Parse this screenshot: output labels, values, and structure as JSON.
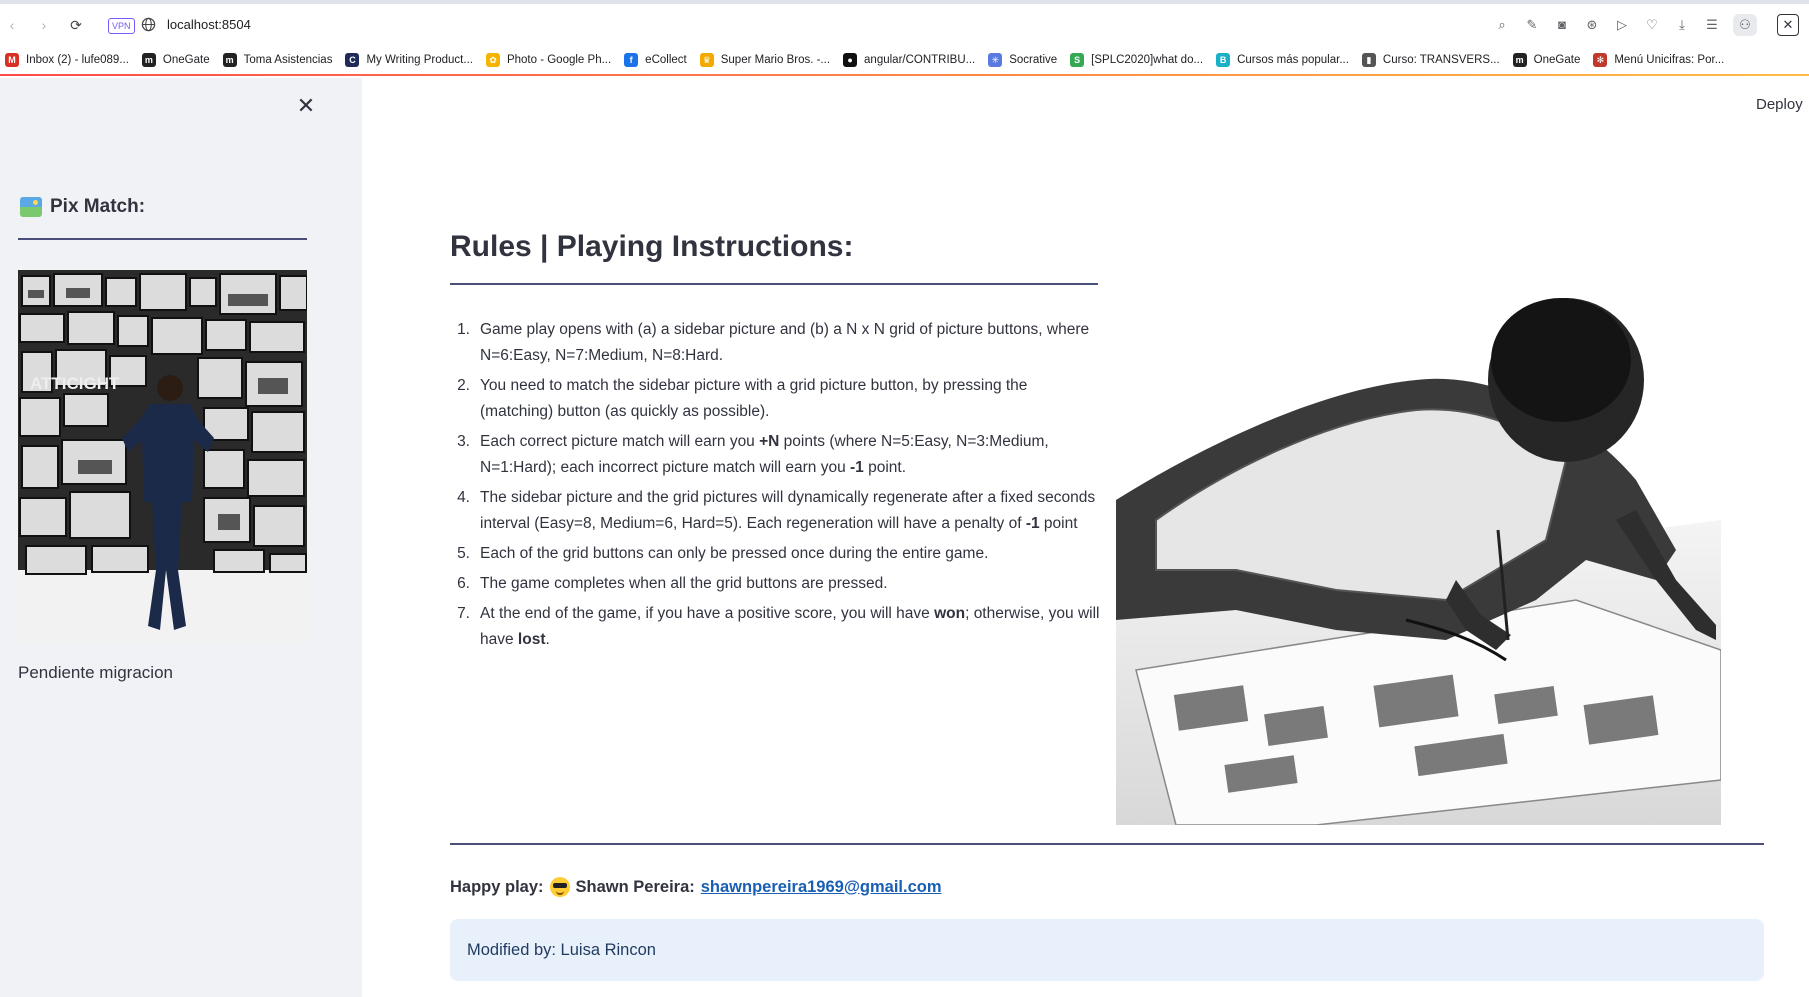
{
  "browser": {
    "url": "localhost:8504",
    "vpn_label": "VPN",
    "bookmarks": [
      {
        "label": "Inbox (2) - lufe089...",
        "color": "#d93025",
        "glyph": "M"
      },
      {
        "label": "OneGate",
        "color": "#222222",
        "glyph": "m"
      },
      {
        "label": "Toma Asistencias",
        "color": "#222222",
        "glyph": "m"
      },
      {
        "label": "My Writing Product...",
        "color": "#1e2b58",
        "glyph": "C"
      },
      {
        "label": "Photo - Google Ph...",
        "color": "#f4b400",
        "glyph": "✿"
      },
      {
        "label": "eCollect",
        "color": "#1a73e8",
        "glyph": "f"
      },
      {
        "label": "Super Mario Bros. -...",
        "color": "#f2a900",
        "glyph": "♛"
      },
      {
        "label": "angular/CONTRIBU...",
        "color": "#111111",
        "glyph": "●"
      },
      {
        "label": "Socrative",
        "color": "#5a7ae0",
        "glyph": "✳"
      },
      {
        "label": "[SPLC2020]what do...",
        "color": "#34a853",
        "glyph": "S"
      },
      {
        "label": "Cursos más popular...",
        "color": "#1ab0c8",
        "glyph": "B"
      },
      {
        "label": "Curso: TRANSVERS...",
        "color": "#555555",
        "glyph": "▮"
      },
      {
        "label": "OneGate",
        "color": "#222222",
        "glyph": "m"
      },
      {
        "label": "Menú Unicifras: Por...",
        "color": "#c0392b",
        "glyph": "✻"
      }
    ]
  },
  "sidebar": {
    "title": "Pix Match:",
    "caption": "Pendiente migracion",
    "image_text": "ATTICIGHT"
  },
  "header": {
    "deploy_label": "Deploy"
  },
  "rules": {
    "title": "Rules | Playing Instructions:",
    "items": [
      {
        "num": "1.",
        "html": "Game play opens with (a) a sidebar picture and (b) a N x N grid of picture buttons, where N=6:Easy, N=7:Medium, N=8:Hard."
      },
      {
        "num": "2.",
        "html": "You need to match the sidebar picture with a grid picture button, by pressing the (matching) button (as quickly as possible)."
      },
      {
        "num": "3.",
        "html": "Each correct picture match will earn you <b>+N</b> points (where N=5:Easy, N=3:Medium, N=1:Hard); each incorrect picture match will earn you <b>-1</b> point."
      },
      {
        "num": "4.",
        "html": "The sidebar picture and the grid pictures will dynamically regenerate after a fixed seconds interval (Easy=8, Medium=6, Hard=5). Each regeneration will have a penalty of <b>-1</b> point"
      },
      {
        "num": "5.",
        "html": "Each of the grid buttons can only be pressed once during the entire game."
      },
      {
        "num": "6.",
        "html": "The game completes when all the grid buttons are pressed."
      },
      {
        "num": "7.",
        "html": "At the end of the game, if you have a positive score, you will have <b>won</b>; otherwise, you will have <b>lost</b>."
      }
    ]
  },
  "footer": {
    "prefix": "Happy play:",
    "author": "Shawn Pereira:",
    "email": "shawnpereira1969@gmail.com",
    "modified": "Modified by: Luisa Rincon"
  }
}
